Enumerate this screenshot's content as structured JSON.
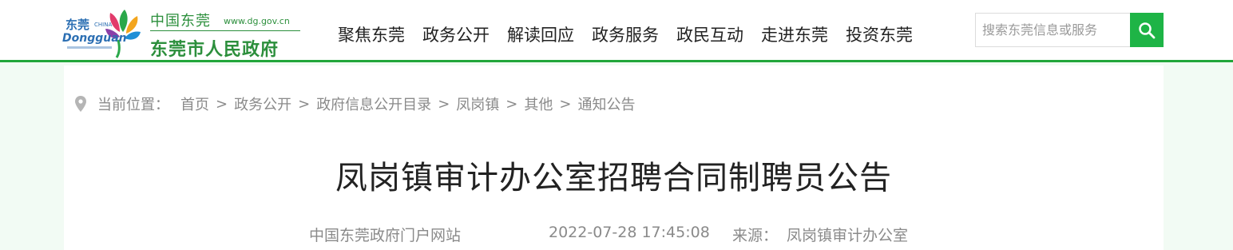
{
  "logo": {
    "cn_top": "中国东莞",
    "url": "www.dg.gov.cn",
    "cn_main": "东莞市人民政府",
    "mark_cn": "东莞",
    "mark_en": "Dongguan",
    "mark_china": "CHINA"
  },
  "nav": [
    "聚焦东莞",
    "政务公开",
    "解读回应",
    "政务服务",
    "政民互动",
    "走进东莞",
    "投资东莞"
  ],
  "search": {
    "placeholder": "搜索东莞信息或服务",
    "button_icon": "search-icon"
  },
  "breadcrumb": {
    "label": "当前位置：",
    "items": [
      "首页",
      "政务公开",
      "政府信息公开目录",
      "凤岗镇",
      "其他",
      "通知公告"
    ],
    "separator": ">"
  },
  "article": {
    "title": "凤岗镇审计办公室招聘合同制聘员公告",
    "site": "中国东莞政府门户网站",
    "date": "2022-07-28 17:45:08",
    "source_label": "来源：",
    "source": "凤岗镇审计办公室"
  },
  "colors": {
    "brand_green": "#22a63a",
    "search_green": "#1eb446",
    "page_bg": "#f2fbf4"
  }
}
